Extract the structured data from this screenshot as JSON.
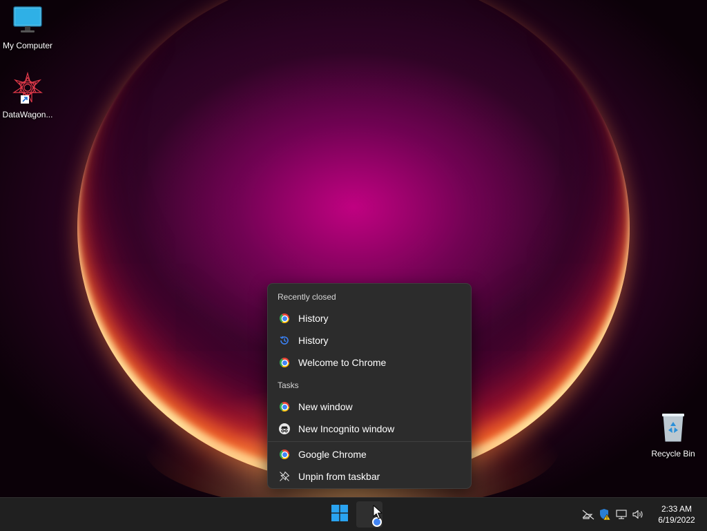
{
  "desktop": {
    "icons": [
      {
        "label": "My Computer"
      },
      {
        "label": "DataWagon..."
      },
      {
        "label": "Recycle Bin"
      }
    ]
  },
  "jumplist": {
    "recently_closed_header": "Recently closed",
    "recently_closed": [
      {
        "label": "History",
        "icon": "chrome-icon"
      },
      {
        "label": "History",
        "icon": "history-icon"
      },
      {
        "label": "Welcome to Chrome",
        "icon": "chrome-icon"
      }
    ],
    "tasks_header": "Tasks",
    "tasks": [
      {
        "label": "New window",
        "icon": "chrome-icon"
      },
      {
        "label": "New Incognito window",
        "icon": "incognito-icon"
      }
    ],
    "app_actions": [
      {
        "label": "Google Chrome",
        "icon": "chrome-icon"
      },
      {
        "label": "Unpin from taskbar",
        "icon": "unpin-icon"
      }
    ]
  },
  "taskbar": {
    "start_icon": "windows-logo-icon",
    "pinned_app": "chrome-icon",
    "tray_icons": [
      "network-disconnected-icon",
      "security-warning-icon",
      "display-icon",
      "volume-icon"
    ],
    "clock": {
      "time": "2:33 AM",
      "date": "6/19/2022"
    }
  },
  "colors": {
    "menu_bg": "#2c2c2c",
    "taskbar_bg": "#202020",
    "windows_blue": "#2aa3f0"
  }
}
